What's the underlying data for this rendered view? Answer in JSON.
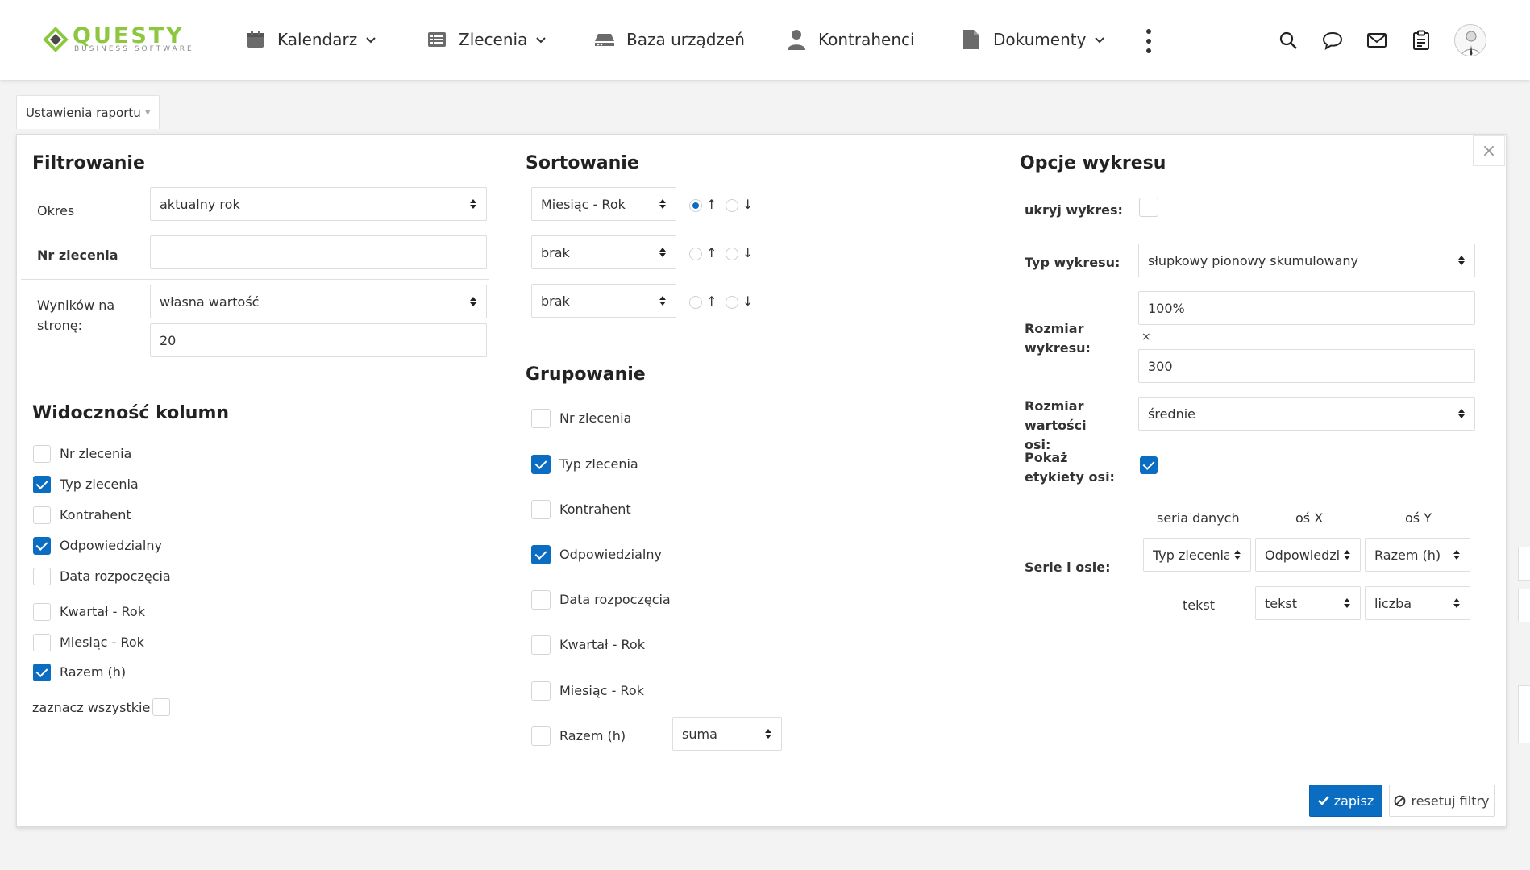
{
  "nav": {
    "logo_text": "QUESTY",
    "logo_subtext": "BUSINESS SOFTWARE",
    "items": [
      {
        "label": "Kalendarz",
        "icon": "calendar-icon",
        "dropdown": true
      },
      {
        "label": "Zlecenia",
        "icon": "list-icon",
        "dropdown": true
      },
      {
        "label": "Baza urządzeń",
        "icon": "device-icon",
        "dropdown": false
      },
      {
        "label": "Kontrahenci",
        "icon": "user-icon",
        "dropdown": false
      },
      {
        "label": "Dokumenty",
        "icon": "document-icon",
        "dropdown": true
      }
    ],
    "right_icons": [
      "search-icon",
      "chat-icon",
      "mail-icon",
      "clipboard-icon"
    ]
  },
  "settings_tab": {
    "label": "Ustawienia raportu"
  },
  "filtering": {
    "title": "Filtrowanie",
    "okres_label": "Okres",
    "okres_value": "aktualny rok",
    "nr_label": "Nr zlecenia",
    "nr_value": "",
    "wynikow_label": "Wyników na stronę:",
    "wynikow_select": "własna wartość",
    "wynikow_value": "20"
  },
  "visibility": {
    "title": "Widoczność kolumn",
    "items": [
      {
        "label": "Nr zlecenia",
        "checked": false
      },
      {
        "label": "Typ zlecenia",
        "checked": true
      },
      {
        "label": "Kontrahent",
        "checked": false
      },
      {
        "label": "Odpowiedzialny",
        "checked": true
      },
      {
        "label": "Data rozpoczęcia",
        "checked": false
      },
      {
        "label": "Kwartał - Rok",
        "checked": false
      },
      {
        "label": "Miesiąc - Rok",
        "checked": false
      },
      {
        "label": "Razem (h)",
        "checked": true
      }
    ],
    "select_all_label": "zaznacz wszystkie",
    "select_all_checked": false
  },
  "sorting": {
    "title": "Sortowanie",
    "rows": [
      {
        "field": "Miesiąc - Rok",
        "asc": true,
        "desc": false
      },
      {
        "field": "brak",
        "asc": false,
        "desc": false
      },
      {
        "field": "brak",
        "asc": false,
        "desc": false
      }
    ],
    "up_arrow": "↑",
    "down_arrow": "↓"
  },
  "grouping": {
    "title": "Grupowanie",
    "items": [
      {
        "label": "Nr zlecenia",
        "checked": false
      },
      {
        "label": "Typ zlecenia",
        "checked": true
      },
      {
        "label": "Kontrahent",
        "checked": false
      },
      {
        "label": "Odpowiedzialny",
        "checked": true
      },
      {
        "label": "Data rozpoczęcia",
        "checked": false
      },
      {
        "label": "Kwartał - Rok",
        "checked": false
      },
      {
        "label": "Miesiąc - Rok",
        "checked": false
      },
      {
        "label": "Razem (h)",
        "checked": false
      }
    ],
    "aggregate_value": "suma"
  },
  "chart_options": {
    "title": "Opcje wykresu",
    "hide_label": "ukryj wykres:",
    "hide_checked": false,
    "type_label": "Typ wykresu:",
    "type_value": "słupkowy pionowy skumulowany",
    "size_label": "Rozmiar wykresu:",
    "size_width": "100%",
    "size_times": "×",
    "size_height": "300",
    "axis_size_label": "Rozmiar wartości osi:",
    "axis_size_value": "średnie",
    "show_labels_label": "Pokaż etykiety osi:",
    "show_labels_checked": true,
    "series_header": {
      "series": "seria danych",
      "x": "oś X",
      "y": "oś Y"
    },
    "series_label": "Serie i osie:",
    "series_row1": {
      "series": "Typ zlecenia",
      "x": "Odpowiedzialny",
      "y": "Razem (h)"
    },
    "series_row2": {
      "series": "tekst",
      "x": "tekst",
      "y": "liczba"
    }
  },
  "actions": {
    "save": "zapisz",
    "reset": "resetuj filtry"
  }
}
